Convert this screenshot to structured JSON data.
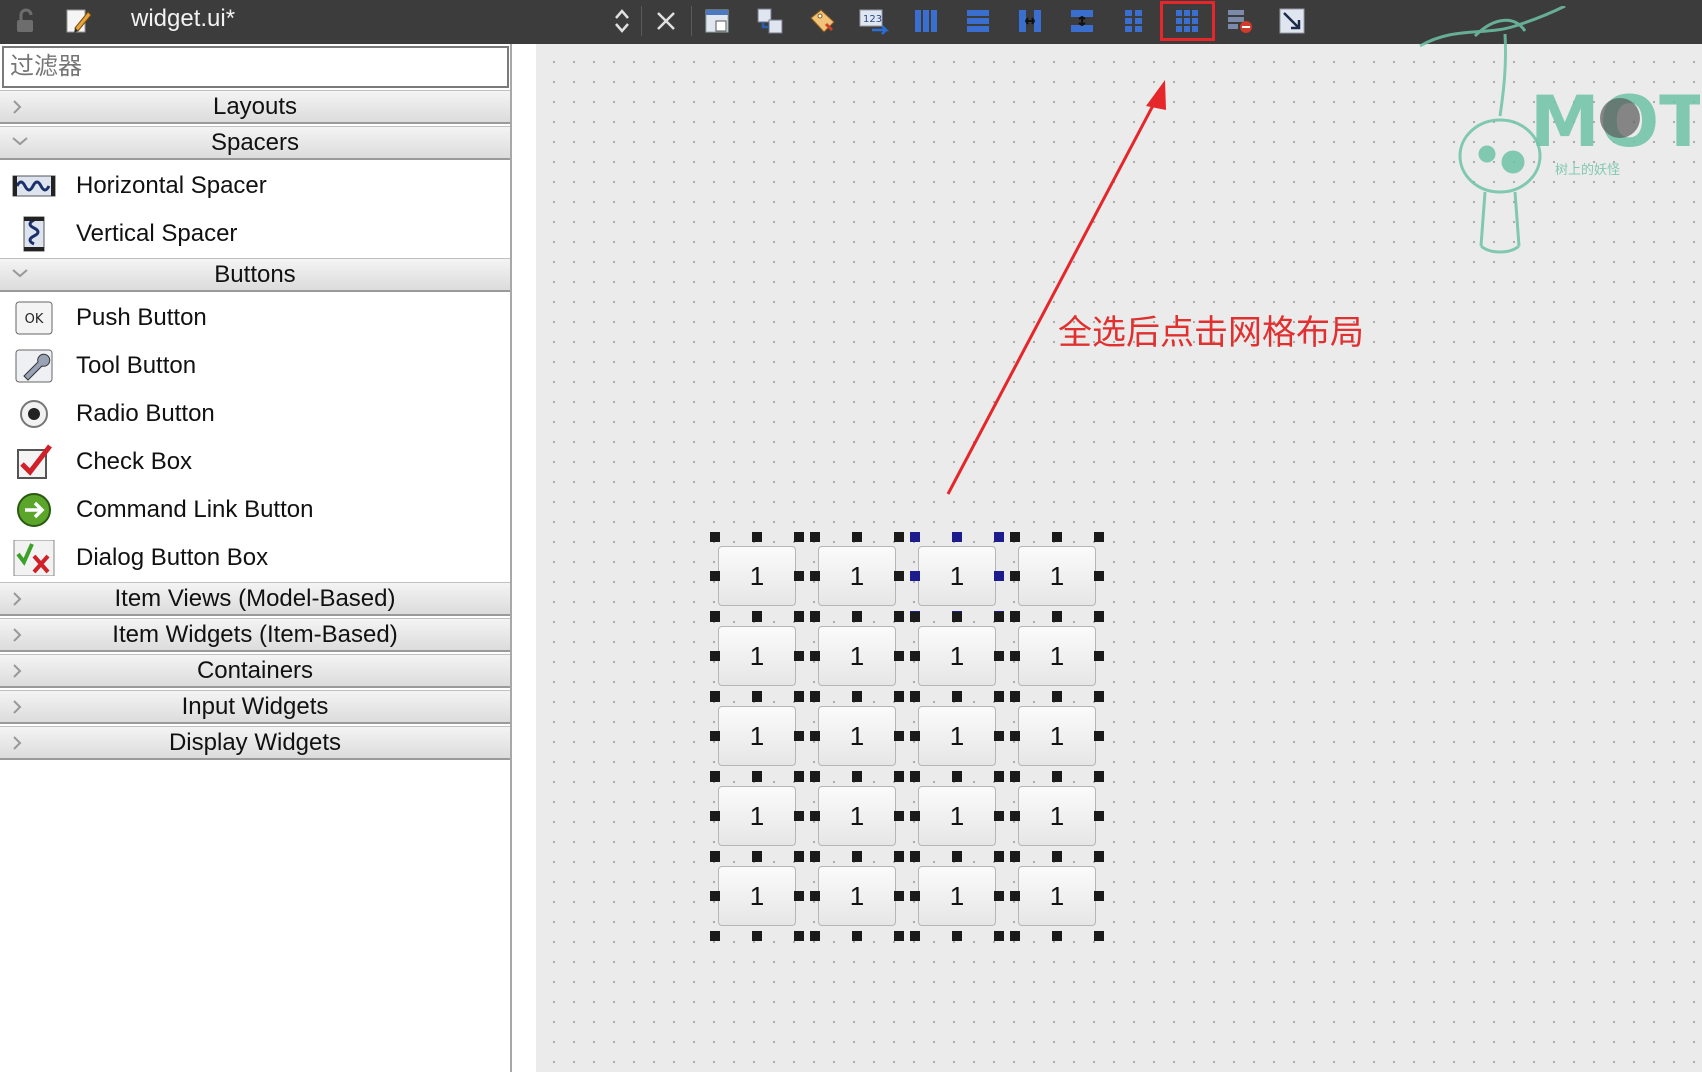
{
  "toolbar": {
    "file_title": "widget.ui*",
    "tools": [
      {
        "name": "lock-icon"
      },
      {
        "name": "edit-file-icon"
      },
      {
        "name": "up-down-arrows-icon"
      },
      {
        "name": "close-icon"
      },
      {
        "name": "edit-widgets-icon"
      },
      {
        "name": "edit-signals-slots-icon"
      },
      {
        "name": "edit-buddies-icon"
      },
      {
        "name": "edit-tab-order-icon"
      },
      {
        "name": "layout-horizontal-icon"
      },
      {
        "name": "layout-vertical-icon"
      },
      {
        "name": "layout-horizontal-splitter-icon"
      },
      {
        "name": "layout-vertical-splitter-icon"
      },
      {
        "name": "layout-form-icon"
      },
      {
        "name": "layout-grid-icon"
      },
      {
        "name": "break-layout-icon"
      },
      {
        "name": "adjust-size-icon"
      }
    ],
    "highlighted_tool": "layout-grid-icon",
    "highlight_color": "#e5262a"
  },
  "widgetbox": {
    "filter_placeholder": "过滤器",
    "categories": {
      "layouts": "Layouts",
      "spacers": "Spacers",
      "buttons": "Buttons",
      "item_views": "Item Views (Model-Based)",
      "item_widgets": "Item Widgets (Item-Based)",
      "containers": "Containers",
      "input_widgets": "Input Widgets",
      "display_widgets": "Display Widgets"
    },
    "spacer_items": [
      {
        "label": "Horizontal Spacer",
        "icon": "horizontal-spacer-icon"
      },
      {
        "label": "Vertical Spacer",
        "icon": "vertical-spacer-icon"
      }
    ],
    "button_items": [
      {
        "label": "Push Button",
        "icon": "push-button-icon",
        "icon_text": "OK"
      },
      {
        "label": "Tool Button",
        "icon": "tool-button-icon"
      },
      {
        "label": "Radio Button",
        "icon": "radio-button-icon"
      },
      {
        "label": "Check Box",
        "icon": "check-box-icon"
      },
      {
        "label": "Command Link Button",
        "icon": "command-link-icon"
      },
      {
        "label": "Dialog Button Box",
        "icon": "dialog-button-box-icon"
      }
    ]
  },
  "form": {
    "button_text": "1",
    "rows": 5,
    "columns": 4
  },
  "annotation": {
    "text": "全选后点击网格布局",
    "color": "#e03030"
  },
  "watermark": {
    "text": "MOT",
    "subtext": "树上的妖怪",
    "color": "#6fc3a8"
  }
}
